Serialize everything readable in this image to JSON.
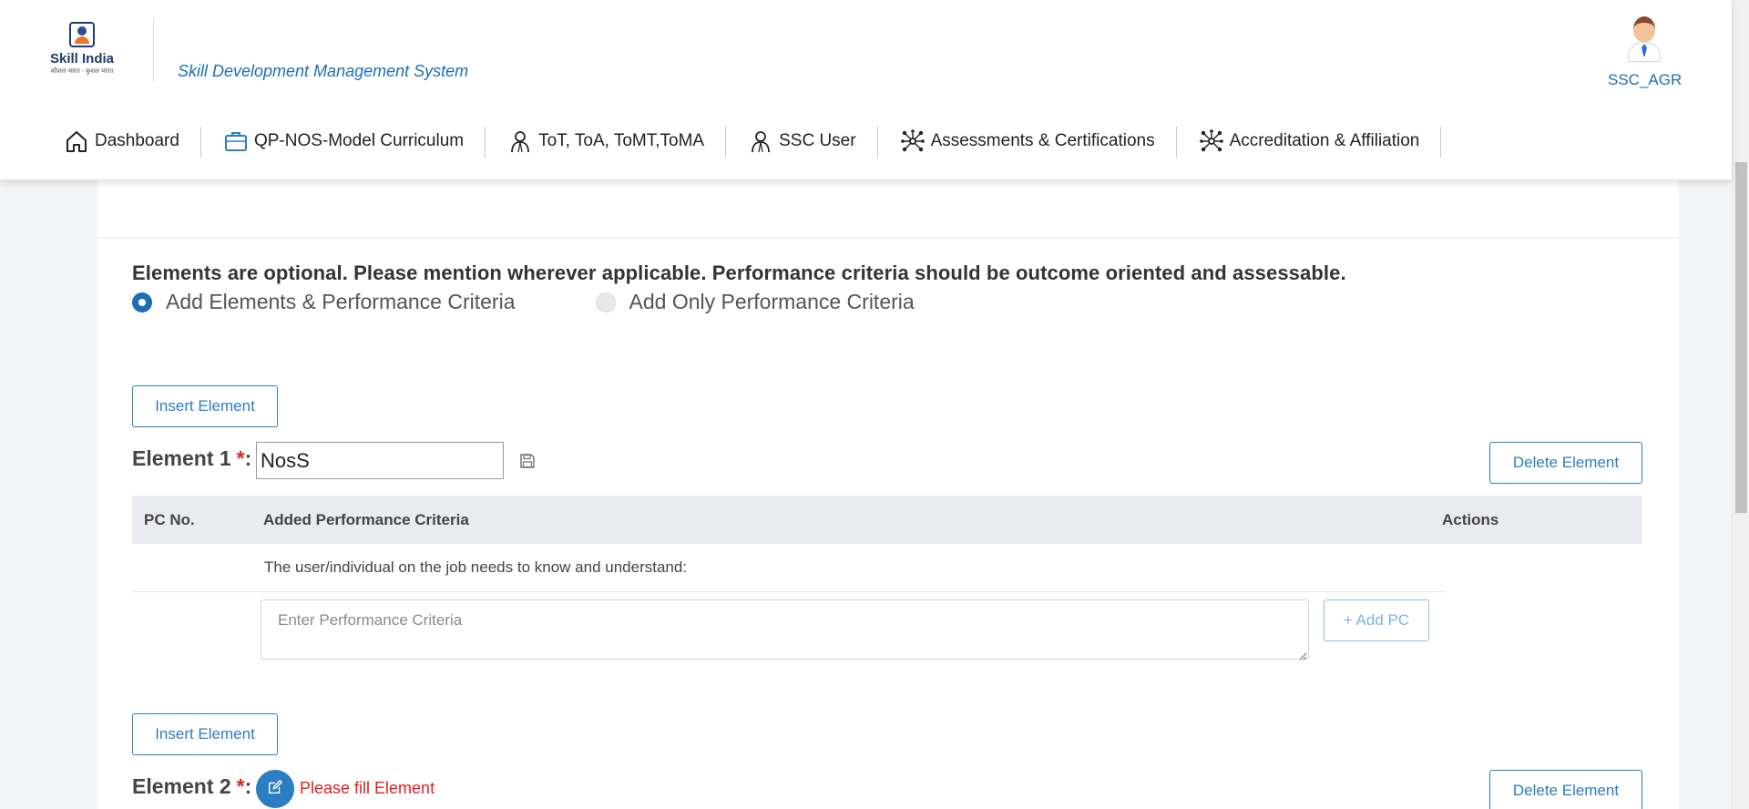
{
  "header": {
    "logo_title": "Skill India",
    "logo_subtitle": "कौशल भारत - कुशल भारत",
    "app_title": "Skill Development Management System",
    "user_name": "SSC_AGR"
  },
  "nav": [
    {
      "label": "Dashboard",
      "icon": "home-icon"
    },
    {
      "label": "QP-NOS-Model Curriculum",
      "icon": "briefcase-icon"
    },
    {
      "label": "ToT, ToA, ToMT,ToMA",
      "icon": "trainer-icon"
    },
    {
      "label": "SSC User",
      "icon": "user-icon"
    },
    {
      "label": "Assessments & Certifications",
      "icon": "network-icon"
    },
    {
      "label": "Accreditation & Affiliation",
      "icon": "network-icon"
    }
  ],
  "form": {
    "note": "Elements are optional. Please mention wherever applicable. Performance criteria should be outcome oriented and assessable.",
    "radio_options": [
      {
        "label": "Add Elements & Performance Criteria",
        "selected": true
      },
      {
        "label": "Add Only Performance Criteria",
        "selected": false
      }
    ],
    "insert_element_label": "Insert Element",
    "delete_element_label": "Delete Element",
    "element1": {
      "label": "Element 1",
      "required_mark": "*",
      "colon": ":",
      "value": "NosS"
    },
    "table": {
      "headers": [
        "PC No.",
        "Added Performance Criteria",
        "Actions"
      ],
      "row_text": "The user/individual on the job needs to know and understand:"
    },
    "pc_placeholder": "Enter Performance Criteria",
    "add_pc_label": "+ Add PC",
    "element2": {
      "label": "Element 2",
      "required_mark": "*",
      "colon": ":",
      "error": "Please fill Element"
    }
  },
  "colors": {
    "primary": "#2b7ec1",
    "error": "#e02020",
    "table_header_bg": "#e9ebef"
  }
}
